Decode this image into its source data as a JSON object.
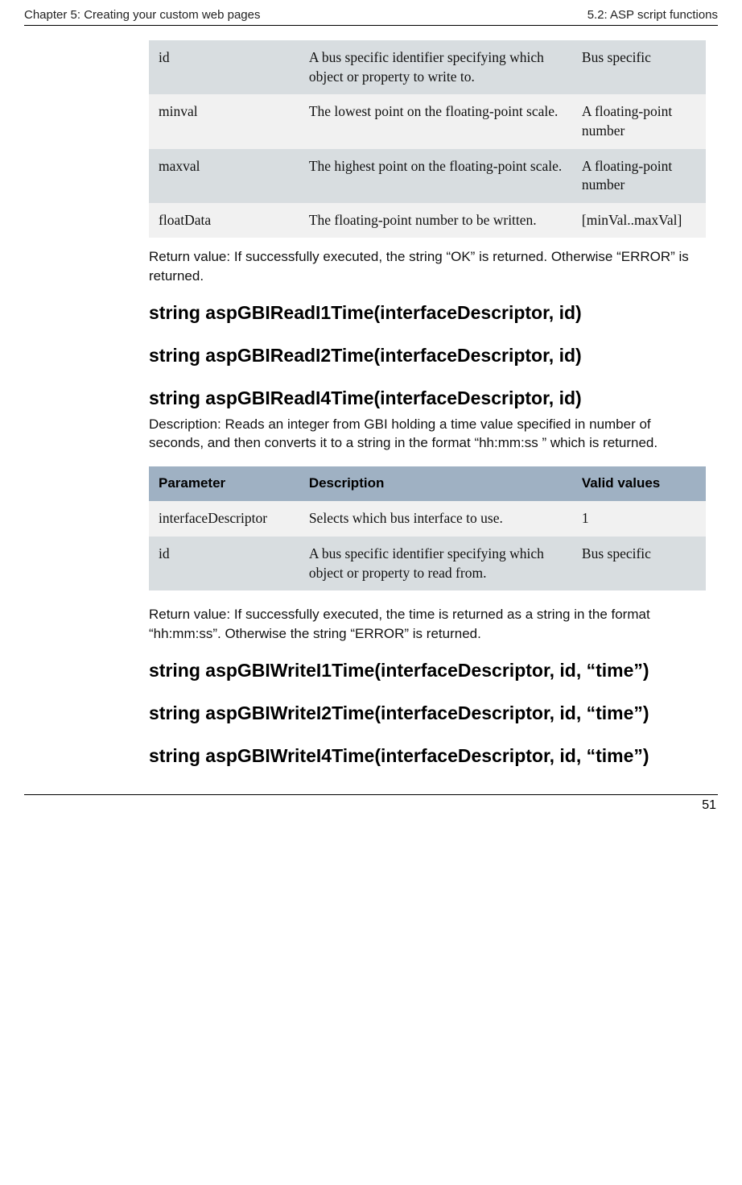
{
  "header": {
    "left": "Chapter 5: Creating your custom web pages",
    "right": "5.2: ASP script functions"
  },
  "table1": {
    "rows": [
      {
        "p": "id",
        "d": "A bus specific identifier specifying which object or property to write to.",
        "v": "Bus specific"
      },
      {
        "p": "minval",
        "d": "The lowest point on the floating-point scale.",
        "v": "A floating-point number"
      },
      {
        "p": "maxval",
        "d": "The highest point on the floating-point scale.",
        "v": "A floating-point number"
      },
      {
        "p": "floatData",
        "d": "The floating-point number to be written.",
        "v": "[minVal..maxVal]"
      }
    ]
  },
  "return1": "Return value: If successfully executed, the string “OK” is returned. Otherwise “ERROR” is returned.",
  "func1": "string aspGBIReadI1Time(interfaceDescriptor, id)",
  "func2": "string aspGBIReadI2Time(interfaceDescriptor, id)",
  "func3": "string aspGBIReadI4Time(interfaceDescriptor, id)",
  "desc1": "Description: Reads an integer from GBI holding a time value specified in number of seconds, and then converts it to a string in the format “hh:mm:ss ” which is returned.",
  "table2": {
    "head": {
      "p": "Parameter",
      "d": "Description",
      "v": "Valid values"
    },
    "rows": [
      {
        "p": "interfaceDescriptor",
        "d": "Selects which bus interface to use.",
        "v": "1"
      },
      {
        "p": "id",
        "d": "A bus specific identifier specifying which object or property to read from.",
        "v": "Bus specific"
      }
    ]
  },
  "return2": "Return value: If successfully executed, the time is returned as a string in the format “hh:mm:ss”. Otherwise the string “ERROR” is returned.",
  "func4": "string aspGBIWriteI1Time(interfaceDescriptor, id, “time”)",
  "func5": "string aspGBIWriteI2Time(interfaceDescriptor, id, “time”)",
  "func6": "string aspGBIWriteI4Time(interfaceDescriptor, id, “time”)",
  "pageNumber": "51"
}
